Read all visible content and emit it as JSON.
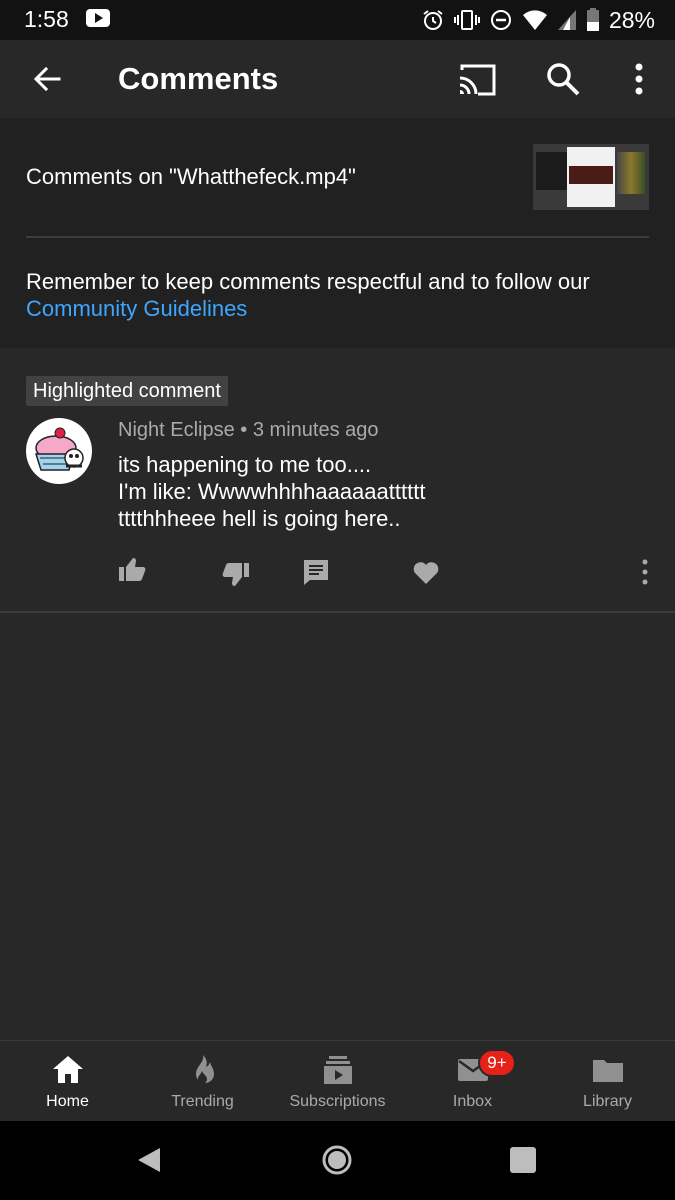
{
  "status_bar": {
    "time": "1:58",
    "battery_percent": "28%",
    "icons": [
      "youtube-icon",
      "alarm-icon",
      "vibrate-icon",
      "dnd-icon",
      "wifi-icon",
      "signal-icon",
      "battery-icon"
    ]
  },
  "app_bar": {
    "title": "Comments",
    "icons": [
      "back-arrow-icon",
      "cast-icon",
      "search-icon",
      "more-vert-icon"
    ]
  },
  "header": {
    "comments_on": "Comments on \"Whatthefeck.mp4\"",
    "guideline_text": "Remember to keep comments respectful and to follow our",
    "guideline_link": "Community Guidelines"
  },
  "comment": {
    "highlight_label": "Highlighted comment",
    "author": "Night Eclipse",
    "separator": "•",
    "time_ago": "3 minutes ago",
    "lines": [
      "its happening to me too....",
      "I'm like: Wwwwhhhhaaaaaatttttt",
      "tttthhheee hell is going here.."
    ],
    "actions": [
      "thumb-up-icon",
      "thumb-down-icon",
      "reply-icon",
      "heart-icon",
      "more-vert-icon"
    ]
  },
  "bottom_nav": {
    "items": [
      {
        "label": "Home",
        "icon": "home-icon",
        "active": true
      },
      {
        "label": "Trending",
        "icon": "trending-icon",
        "active": false
      },
      {
        "label": "Subscriptions",
        "icon": "subscriptions-icon",
        "active": false
      },
      {
        "label": "Inbox",
        "icon": "inbox-icon",
        "active": false
      },
      {
        "label": "Library",
        "icon": "library-icon",
        "active": false
      }
    ],
    "inbox_badge": "9+"
  },
  "colors": {
    "background": "#282828",
    "panel": "#212121",
    "status_bar": "#121212",
    "link": "#3ea6ff",
    "badge": "#e62117",
    "secondary_text": "#aaaaaa"
  }
}
